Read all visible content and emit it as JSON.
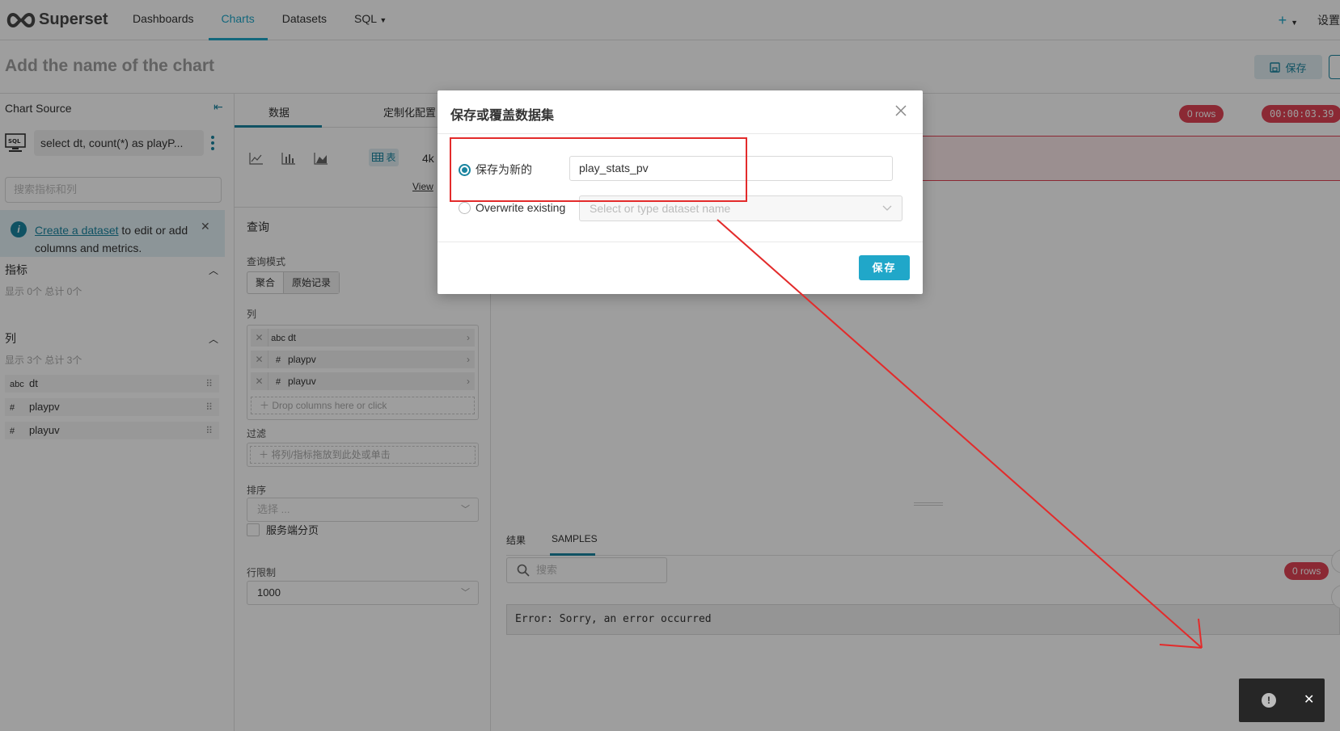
{
  "nav": {
    "brand": "Superset",
    "items": [
      "Dashboards",
      "Charts",
      "Datasets",
      "SQL"
    ],
    "active_index": 1,
    "settings": "设置"
  },
  "title": {
    "chart_name": "Add the name of the chart",
    "save_label": "保存"
  },
  "left": {
    "header": "Chart Source",
    "sql_preview": "select dt, count(*) as playP...",
    "search_placeholder": "搜索指标和列",
    "info_link": "Create a dataset",
    "info_rest": " to edit or add columns and metrics.",
    "metrics_title": "指标",
    "metrics_meta": "显示 0个 总计 0个",
    "columns_title": "列",
    "columns_meta": "显示 3个 总计 3个",
    "columns": [
      {
        "type": "abc",
        "name": "dt"
      },
      {
        "type": "#",
        "name": "playpv"
      },
      {
        "type": "#",
        "name": "playuv"
      }
    ]
  },
  "middle": {
    "tab_data": "数据",
    "tab_custom": "定制化配置",
    "viz_table_label": "表",
    "viz_4k": "4k",
    "viz_view": "View",
    "query_title": "查询",
    "query_mode_label": "查询模式",
    "mode_aggregate": "聚合",
    "mode_raw": "原始记录",
    "columns_label": "列",
    "columns": [
      {
        "type": "abc",
        "name": "dt"
      },
      {
        "type": "#",
        "name": "playpv"
      },
      {
        "type": "#",
        "name": "playuv"
      }
    ],
    "drop_columns": "Drop columns here or click",
    "filter_label": "过滤",
    "filter_drop": "将列/指标拖放到此处或单击",
    "sort_label": "排序",
    "sort_placeholder": "选择 ...",
    "server_pagination": "服务端分页",
    "row_limit_label": "行限制",
    "row_limit_value": "1000"
  },
  "right": {
    "rows_pill": "0 rows",
    "timer_pill": "00:00:03.39",
    "tab_results": "结果",
    "tab_samples": "SAMPLES",
    "search_placeholder": "搜索",
    "samples_rows": "0 rows",
    "error_text": "Error: Sorry, an error occurred"
  },
  "modal": {
    "title": "保存或覆盖数据集",
    "option_new": "保存为新的",
    "new_name_value": "play_stats_pv",
    "option_overwrite": "Overwrite existing",
    "overwrite_placeholder": "Select or type dataset name",
    "save_button": "保存"
  },
  "colors": {
    "brand": "#20a7c9",
    "primary_dark": "#1a85a0",
    "danger": "#e04355",
    "annotation": "#e32b2b"
  }
}
